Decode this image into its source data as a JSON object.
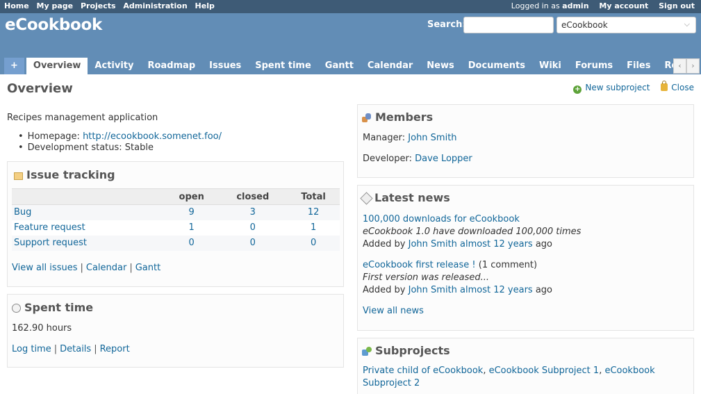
{
  "top_menu": {
    "items": [
      "Home",
      "My page",
      "Projects",
      "Administration",
      "Help"
    ],
    "logged_prefix": "Logged in as",
    "logged_user": "admin",
    "my_account": "My account",
    "sign_out": "Sign out"
  },
  "header": {
    "project_title": "eCookbook",
    "search_label": "Search:",
    "search_value": "",
    "project_jump": "eCookbook"
  },
  "tabs": [
    "+",
    "Overview",
    "Activity",
    "Roadmap",
    "Issues",
    "Spent time",
    "Gantt",
    "Calendar",
    "News",
    "Documents",
    "Wiki",
    "Forums",
    "Files",
    "Repos"
  ],
  "main": {
    "title": "Overview",
    "new_subproject": "New subproject",
    "close": "Close",
    "description": "Recipes management application",
    "homepage_label": "Homepage:",
    "homepage_url": "http://ecookbook.somenet.foo/",
    "dev_status_label": "Development status:",
    "dev_status": "Stable"
  },
  "issue_tracking": {
    "title": "Issue tracking",
    "headers": [
      "",
      "open",
      "closed",
      "Total"
    ],
    "rows": [
      {
        "tracker": "Bug",
        "open": "9",
        "closed": "3",
        "total": "12"
      },
      {
        "tracker": "Feature request",
        "open": "1",
        "closed": "0",
        "total": "1"
      },
      {
        "tracker": "Support request",
        "open": "0",
        "closed": "0",
        "total": "0"
      }
    ],
    "links": [
      "View all issues",
      "Calendar",
      "Gantt"
    ]
  },
  "spent_time": {
    "title": "Spent time",
    "hours": "162.90 hours",
    "links": [
      "Log time",
      "Details",
      "Report"
    ]
  },
  "members": {
    "title": "Members",
    "manager_label": "Manager:",
    "manager": "John Smith",
    "developer_label": "Developer:",
    "developer": "Dave Lopper"
  },
  "news": {
    "title": "Latest news",
    "items": [
      {
        "title": "100,000 downloads for eCookbook",
        "comments": "",
        "summary": "eCookbook 1.0 have downloaded 100,000 times",
        "added_by": "Added by",
        "author": "John Smith",
        "age": "almost 12 years",
        "ago": "ago"
      },
      {
        "title": "eCookbook first release !",
        "comments": "(1 comment)",
        "summary": "First version was released...",
        "added_by": "Added by",
        "author": "John Smith",
        "age": "almost 12 years",
        "ago": "ago"
      }
    ],
    "view_all": "View all news"
  },
  "subprojects": {
    "title": "Subprojects",
    "items": [
      "Private child of eCookbook",
      "eCookbook Subproject 1",
      "eCookbook Subproject 2"
    ]
  }
}
